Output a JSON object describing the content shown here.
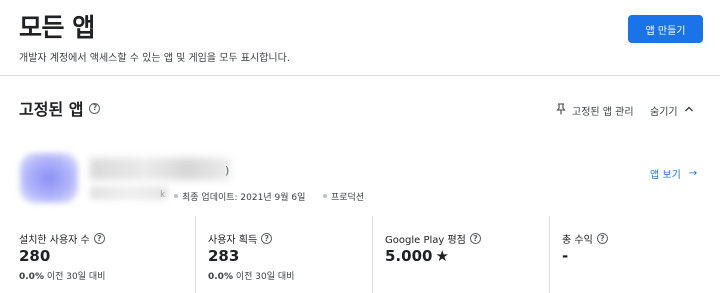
{
  "header": {
    "title": "모든 앱",
    "subtitle": "개발자 계정에서 액세스할 수 있는 앱 및 게임을 모두 표시합니다.",
    "create_button": "앱 만들기"
  },
  "pinned": {
    "title": "고정된 앱",
    "manage_label": "고정된 앱 관리",
    "hide_label": "숨기기",
    "app": {
      "name_suffix": ")",
      "package_suffix": "k",
      "last_update": "최종 업데이트: 2021년 9월 6일",
      "status": "프로덕션",
      "view_label": "앱 보기"
    }
  },
  "stats": [
    {
      "label": "설치한 사용자 수",
      "value": "280",
      "change_pct": "0.0%",
      "change_text": "이전 30일 대비"
    },
    {
      "label": "사용자 획득",
      "value": "283",
      "change_pct": "0.0%",
      "change_text": "이전 30일 대비"
    },
    {
      "label": "Google Play 평점",
      "value": "5.000",
      "star": "★"
    },
    {
      "label": "총 수익",
      "value": "-"
    }
  ],
  "icons": {
    "help": "?",
    "arrow_right": "→"
  },
  "colors": {
    "accent": "#1a73e8",
    "text": "#202124",
    "divider": "#dadce0"
  }
}
